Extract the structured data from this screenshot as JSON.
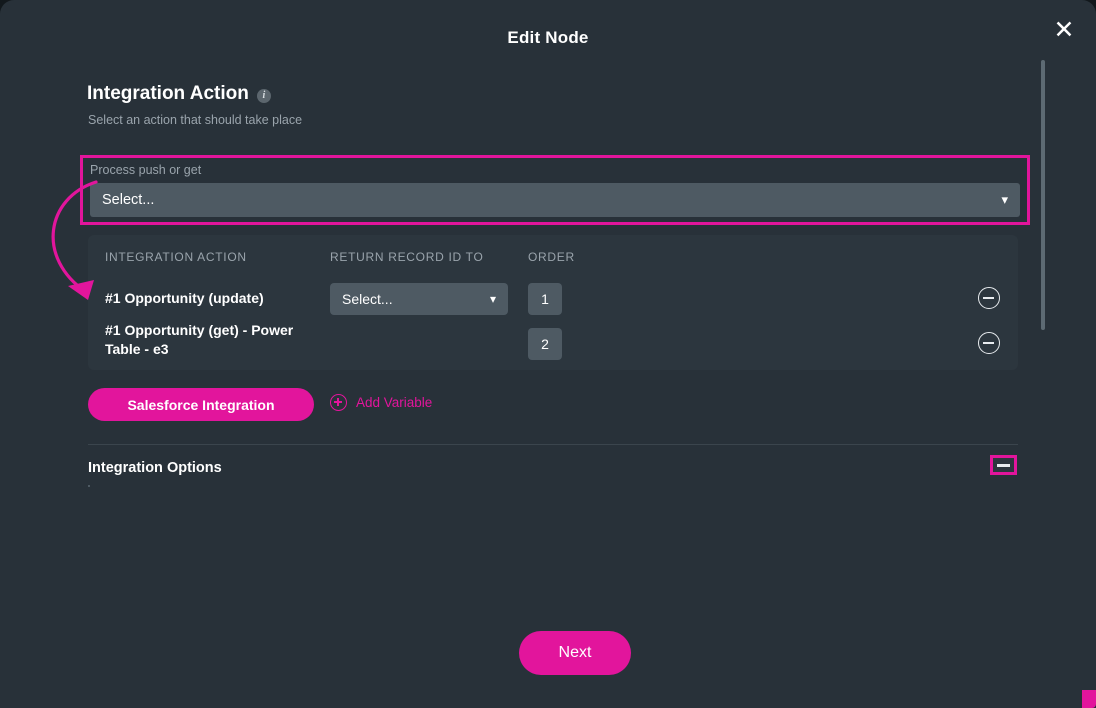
{
  "modal": {
    "title": "Edit Node",
    "close_icon": "close-icon"
  },
  "section": {
    "heading": "Integration Action",
    "info_icon": "info-icon",
    "subheading": "Select an action that should take place"
  },
  "process_field": {
    "label": "Process push or get",
    "value": "Select...",
    "placeholder": "Select...",
    "chevron_icon": "chevron-down-icon",
    "highlight_color": "#e2159c"
  },
  "table": {
    "columns": [
      "INTEGRATION ACTION",
      "RETURN RECORD ID TO",
      "ORDER"
    ],
    "rows": [
      {
        "integration_action": "#1 Opportunity (update)",
        "return_record_id_to": "Select...",
        "order": "1",
        "remove_icon": "circle-minus-icon"
      },
      {
        "integration_action": "#1 Opportunity (get) - Power Table - e3",
        "return_record_id_to": "",
        "order": "2",
        "remove_icon": "circle-minus-icon"
      }
    ]
  },
  "actions": {
    "salesforce_button": "Salesforce Integration",
    "add_variable": "Add Variable",
    "add_variable_icon": "plus-circle-icon"
  },
  "options": {
    "title": "Integration Options",
    "collapse_icon": "minus-icon"
  },
  "footer": {
    "next_button": "Next"
  },
  "colors": {
    "accent": "#e2159c",
    "panel": "#2c363e",
    "background": "#283139",
    "field": "#4e5a63"
  }
}
